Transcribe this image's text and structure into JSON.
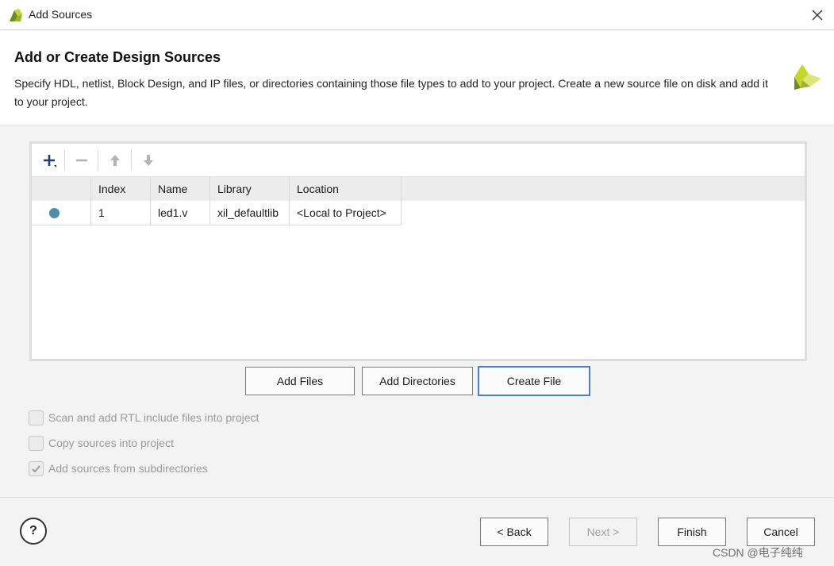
{
  "window": {
    "title": "Add Sources",
    "close_glyph": "✕",
    "icon": "xilinx-logo-icon"
  },
  "header": {
    "heading": "Add or Create Design Sources",
    "description": "Specify HDL, netlist, Block Design, and IP files, or directories containing those file types to add to your project. Create a new source file on disk and add it to your project."
  },
  "toolbar": {
    "add_icon": "plus-icon",
    "remove_icon": "minus-icon",
    "up_icon": "arrow-up-icon",
    "down_icon": "arrow-down-icon"
  },
  "table": {
    "columns": [
      "",
      "Index",
      "Name",
      "Library",
      "Location"
    ],
    "rows": [
      {
        "status": "source-dot",
        "index": "1",
        "name": "led1.v",
        "library": "xil_defaultlib",
        "location": "<Local to Project>"
      }
    ]
  },
  "actions": {
    "add_files": "Add Files",
    "add_directories": "Add Directories",
    "create_file": "Create File"
  },
  "options": [
    {
      "label": "Scan and add RTL include files into project",
      "checked": false,
      "enabled": false
    },
    {
      "label": "Copy sources into project",
      "checked": false,
      "enabled": false
    },
    {
      "label": "Add sources from subdirectories",
      "checked": true,
      "enabled": false
    }
  ],
  "footer": {
    "help": "?",
    "back": "< Back",
    "next": "Next >",
    "finish": "Finish",
    "cancel": "Cancel"
  },
  "watermark": "CSDN @电子纯纯",
  "colors": {
    "accent": "#4a7fd4",
    "dot": "#4b8ea8",
    "logo_dark": "#6b8c1f",
    "logo_light": "#c4d62d"
  }
}
